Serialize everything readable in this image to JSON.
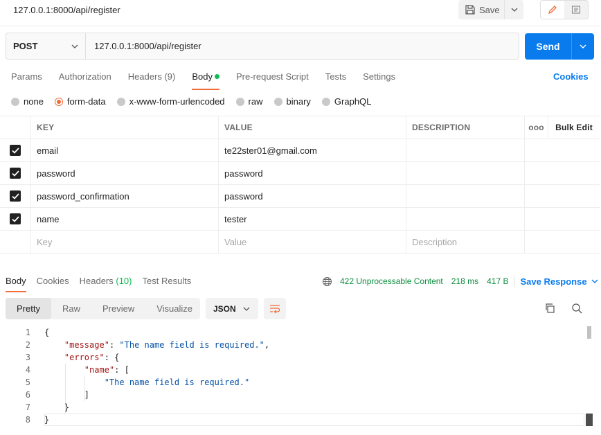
{
  "topbar": {
    "title": "127.0.0.1:8000/api/register",
    "save_label": "Save"
  },
  "request": {
    "method": "POST",
    "url": "127.0.0.1:8000/api/register",
    "send_label": "Send"
  },
  "req_tabs": [
    {
      "label": "Params",
      "count": ""
    },
    {
      "label": "Authorization",
      "count": ""
    },
    {
      "label": "Headers",
      "count": "(9)"
    },
    {
      "label": "Body",
      "count": ""
    },
    {
      "label": "Pre-request Script",
      "count": ""
    },
    {
      "label": "Tests",
      "count": ""
    },
    {
      "label": "Settings",
      "count": ""
    }
  ],
  "cookies_label": "Cookies",
  "body_types": [
    "none",
    "form-data",
    "x-www-form-urlencoded",
    "raw",
    "binary",
    "GraphQL"
  ],
  "table": {
    "headers": {
      "key": "KEY",
      "value": "VALUE",
      "description": "DESCRIPTION",
      "more": "ooo",
      "bulk_edit": "Bulk Edit"
    },
    "rows": [
      {
        "key": "email",
        "value": "te22ster01@gmail.com",
        "description": ""
      },
      {
        "key": "password",
        "value": "password",
        "description": ""
      },
      {
        "key": "password_confirmation",
        "value": "password",
        "description": ""
      },
      {
        "key": "name",
        "value": "tester",
        "description": ""
      }
    ],
    "placeholders": {
      "key": "Key",
      "value": "Value",
      "description": "Description"
    }
  },
  "response": {
    "tabs": [
      {
        "label": "Body",
        "count": ""
      },
      {
        "label": "Cookies",
        "count": ""
      },
      {
        "label": "Headers",
        "count": "(10)"
      },
      {
        "label": "Test Results",
        "count": ""
      }
    ],
    "status": "422 Unprocessable Content",
    "time": "218 ms",
    "size": "417 B",
    "save_response_label": "Save Response",
    "view_tabs": [
      "Pretty",
      "Raw",
      "Preview",
      "Visualize"
    ],
    "format": "JSON",
    "line_numbers": [
      "1",
      "2",
      "3",
      "4",
      "5",
      "6",
      "7",
      "8"
    ],
    "json": {
      "message_key": "\"message\"",
      "message_value": "\"The name field is required.\"",
      "errors_key": "\"errors\"",
      "name_key": "\"name\"",
      "name_value": "\"The name field is required.\""
    }
  },
  "colors": {
    "accent": "#f26b3a",
    "primary": "#097bed",
    "success": "#0cbb52"
  }
}
